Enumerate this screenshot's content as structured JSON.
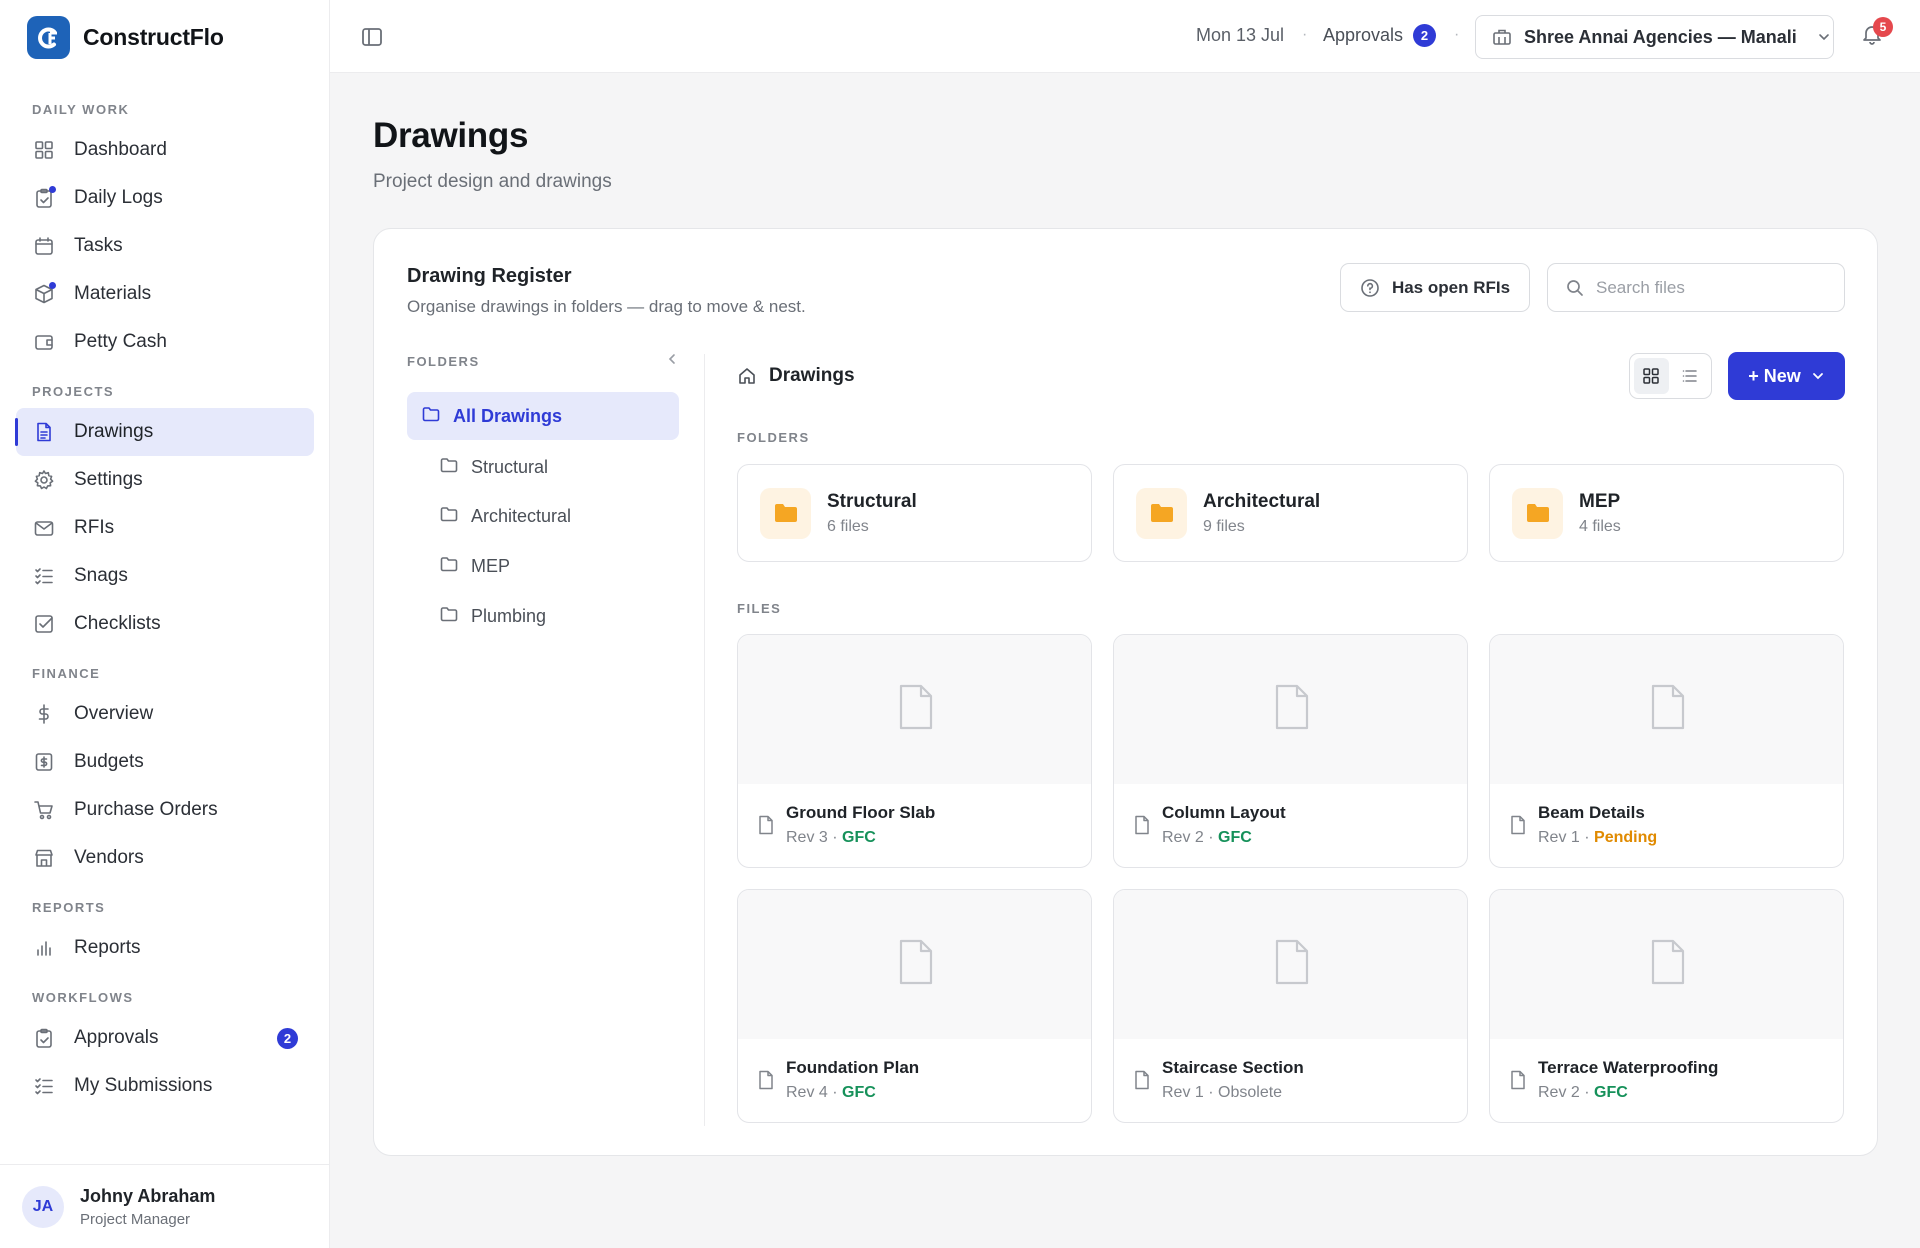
{
  "brand": {
    "name": "ConstructFlo",
    "logo_text": "CF"
  },
  "sidebar": {
    "sections": [
      {
        "label": "DAILY WORK",
        "items": [
          {
            "label": "Dashboard",
            "icon": "grid-icon"
          },
          {
            "label": "Daily Logs",
            "icon": "clipboard-icon",
            "dot": true
          },
          {
            "label": "Tasks",
            "icon": "calendar-icon"
          },
          {
            "label": "Materials",
            "icon": "box-icon",
            "dot": true
          },
          {
            "label": "Petty Cash",
            "icon": "wallet-icon"
          }
        ]
      },
      {
        "label": "PROJECTS",
        "items": [
          {
            "label": "Drawings",
            "icon": "document-icon",
            "active": true
          },
          {
            "label": "Settings",
            "icon": "gear-icon"
          },
          {
            "label": "RFIs",
            "icon": "mail-icon"
          },
          {
            "label": "Snags",
            "icon": "checklist-icon"
          },
          {
            "label": "Checklists",
            "icon": "checkbox-icon"
          }
        ]
      },
      {
        "label": "FINANCE",
        "items": [
          {
            "label": "Overview",
            "icon": "dollar-icon"
          },
          {
            "label": "Budgets",
            "icon": "budget-icon"
          },
          {
            "label": "Purchase Orders",
            "icon": "cart-icon"
          },
          {
            "label": "Vendors",
            "icon": "store-icon"
          }
        ]
      },
      {
        "label": "REPORTS",
        "items": [
          {
            "label": "Reports",
            "icon": "bar-chart-icon"
          }
        ]
      },
      {
        "label": "WORKFLOWS",
        "items": [
          {
            "label": "Approvals",
            "icon": "clipboard-check-icon",
            "badge": "2"
          },
          {
            "label": "My Submissions",
            "icon": "checklist-icon"
          }
        ]
      }
    ],
    "user": {
      "initials": "JA",
      "name": "Johny Abraham",
      "role": "Project Manager"
    }
  },
  "topbar": {
    "date": "Mon 13 Jul",
    "sep": "·",
    "approvals_label": "Approvals",
    "approvals_count": "2",
    "org": "Shree Annai Agencies — Manali",
    "notifications": "5"
  },
  "page": {
    "title": "Drawings",
    "subtitle": "Project design and drawings"
  },
  "register": {
    "title": "Drawing Register",
    "subtitle": "Organise drawings in folders — drag to move & nest.",
    "rfi_filter": "Has open RFIs",
    "search_placeholder": "Search files"
  },
  "folder_tree": {
    "heading": "FOLDERS",
    "items": [
      {
        "label": "All Drawings",
        "active": true
      },
      {
        "label": "Structural"
      },
      {
        "label": "Architectural"
      },
      {
        "label": "MEP"
      },
      {
        "label": "Plumbing"
      }
    ]
  },
  "content": {
    "breadcrumb": "Drawings",
    "new_button": "+ New",
    "folders_label": "FOLDERS",
    "files_label": "FILES",
    "folders": [
      {
        "name": "Structural",
        "count": "6 files"
      },
      {
        "name": "Architectural",
        "count": "9 files"
      },
      {
        "name": "MEP",
        "count": "4 files"
      }
    ],
    "files": [
      {
        "name": "Ground Floor Slab",
        "rev": "Rev 3 · ",
        "status": "GFC",
        "status_type": "gfc"
      },
      {
        "name": "Column Layout",
        "rev": "Rev 2 · ",
        "status": "GFC",
        "status_type": "gfc"
      },
      {
        "name": "Beam Details",
        "rev": "Rev 1 · ",
        "status": "Pending",
        "status_type": "pending"
      },
      {
        "name": "Foundation Plan",
        "rev": "Rev 4 · ",
        "status": "GFC",
        "status_type": "gfc"
      },
      {
        "name": "Staircase Section",
        "rev": "Rev 1 · ",
        "status": "Obsolete",
        "status_type": "obsolete"
      },
      {
        "name": "Terrace Waterproofing",
        "rev": "Rev 2 · ",
        "status": "GFC",
        "status_type": "gfc"
      }
    ]
  },
  "colors": {
    "accent": "#2f3bd6",
    "brand": "#1e63b8",
    "gfc": "#16915a",
    "pending": "#e08a00",
    "folder": "#f5a623",
    "alert": "#e5484d"
  }
}
